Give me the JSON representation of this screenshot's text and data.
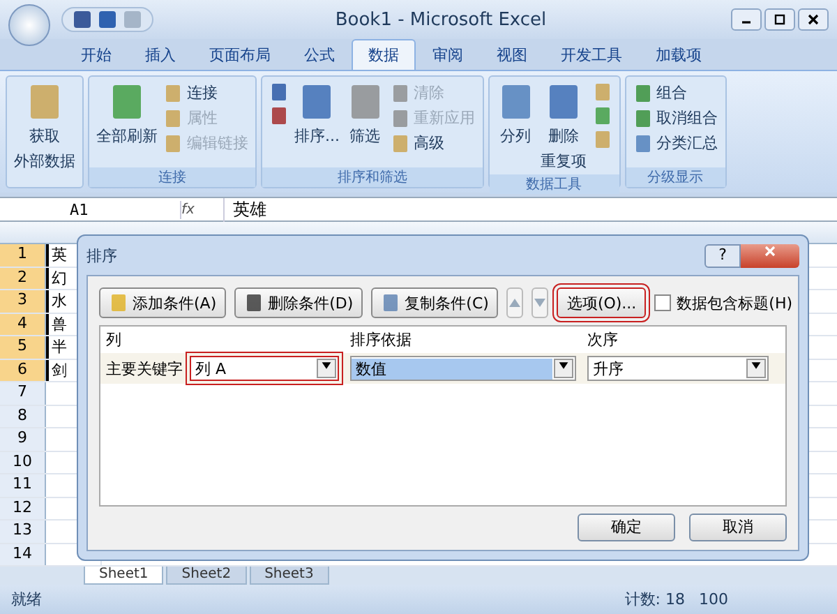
{
  "window": {
    "title": "Book1 - Microsoft Excel"
  },
  "tabs": [
    {
      "label": "开始",
      "selected": false
    },
    {
      "label": "插入",
      "selected": false
    },
    {
      "label": "页面布局",
      "selected": false
    },
    {
      "label": "公式",
      "selected": false
    },
    {
      "label": "数据",
      "selected": true
    },
    {
      "label": "审阅",
      "selected": false
    },
    {
      "label": "视图",
      "selected": false
    },
    {
      "label": "开发工具",
      "selected": false
    },
    {
      "label": "加载项",
      "selected": false
    }
  ],
  "ribbon_groups": [
    {
      "items": [
        {
          "kind": "large",
          "lines": [
            "获取",
            "外部数据"
          ],
          "disabled": false
        }
      ]
    },
    {
      "title": "连接",
      "items": [
        {
          "kind": "large",
          "lines": [
            "全部刷新"
          ],
          "disabled": false
        },
        {
          "kind": "stack",
          "entries": [
            {
              "label": "连接",
              "disabled": false
            },
            {
              "label": "属性",
              "disabled": true
            },
            {
              "label": "编辑链接",
              "disabled": true
            }
          ]
        }
      ]
    },
    {
      "title": "排序和筛选",
      "items": [
        {
          "kind": "icons"
        },
        {
          "kind": "large",
          "lines": [
            "排序..."
          ],
          "disabled": false
        },
        {
          "kind": "large",
          "lines": [
            "筛选"
          ],
          "disabled": false
        },
        {
          "kind": "stack",
          "entries": [
            {
              "label": "清除",
              "disabled": true
            },
            {
              "label": "重新应用",
              "disabled": true
            },
            {
              "label": "高级",
              "disabled": false
            }
          ]
        }
      ]
    },
    {
      "title": "数据工具",
      "items": [
        {
          "kind": "large",
          "lines": [
            "分列"
          ],
          "disabled": false
        },
        {
          "kind": "large",
          "lines": [
            "删除",
            "重复项"
          ],
          "disabled": false
        },
        {
          "kind": "icons"
        }
      ]
    },
    {
      "title": "分级显示",
      "items": [
        {
          "kind": "stack",
          "entries": [
            {
              "label": "组合",
              "disabled": false
            },
            {
              "label": "取消组合",
              "disabled": false
            },
            {
              "label": "分类汇总",
              "disabled": false
            }
          ]
        }
      ]
    }
  ],
  "formula_bar": {
    "name_box": "A1",
    "fx": "fx",
    "value": "英雄"
  },
  "rows": [
    {
      "number": "1",
      "cell": "英"
    },
    {
      "number": "2",
      "cell": "幻"
    },
    {
      "number": "3",
      "cell": "水"
    },
    {
      "number": "4",
      "cell": "兽"
    },
    {
      "number": "5",
      "cell": "半"
    },
    {
      "number": "6",
      "cell": "剑"
    },
    {
      "number": "7"
    },
    {
      "number": "8"
    },
    {
      "number": "9"
    },
    {
      "number": "10"
    },
    {
      "number": "11"
    },
    {
      "number": "12"
    },
    {
      "number": "13"
    },
    {
      "number": "14"
    }
  ],
  "sheet_tabs": [
    {
      "label": "Sheet1",
      "selected": true
    },
    {
      "label": "Sheet2",
      "selected": false
    },
    {
      "label": "Sheet3",
      "selected": false
    }
  ],
  "status_bar": {
    "ready": "就绪",
    "count": "计数: 18",
    "zoom": "100"
  },
  "dialog": {
    "title": "排序",
    "help": "?",
    "toolbar": [
      {
        "kind": "button",
        "label": "添加条件(A)",
        "highlighted": false
      },
      {
        "kind": "button",
        "label": "删除条件(D)",
        "highlighted": false
      },
      {
        "kind": "button",
        "label": "复制条件(C)",
        "highlighted": false
      },
      {
        "kind": "up",
        "highlighted": false
      },
      {
        "kind": "down",
        "highlighted": false
      },
      {
        "kind": "button",
        "label": "选项(O)...",
        "highlighted": true
      }
    ],
    "has_headers": {
      "label": "数据包含标题(H)",
      "checked": false
    },
    "columns": [
      "列",
      "排序依据",
      "次序"
    ],
    "rows": [
      {
        "label": "主要关键字",
        "column": {
          "value": "列 A",
          "highlighted": true,
          "selected": false
        },
        "sort_on": {
          "value": "数值",
          "highlighted": false,
          "selected": true
        },
        "order": {
          "value": "升序",
          "highlighted": false,
          "selected": false
        }
      }
    ],
    "buttons": [
      "确定",
      "取消"
    ]
  }
}
